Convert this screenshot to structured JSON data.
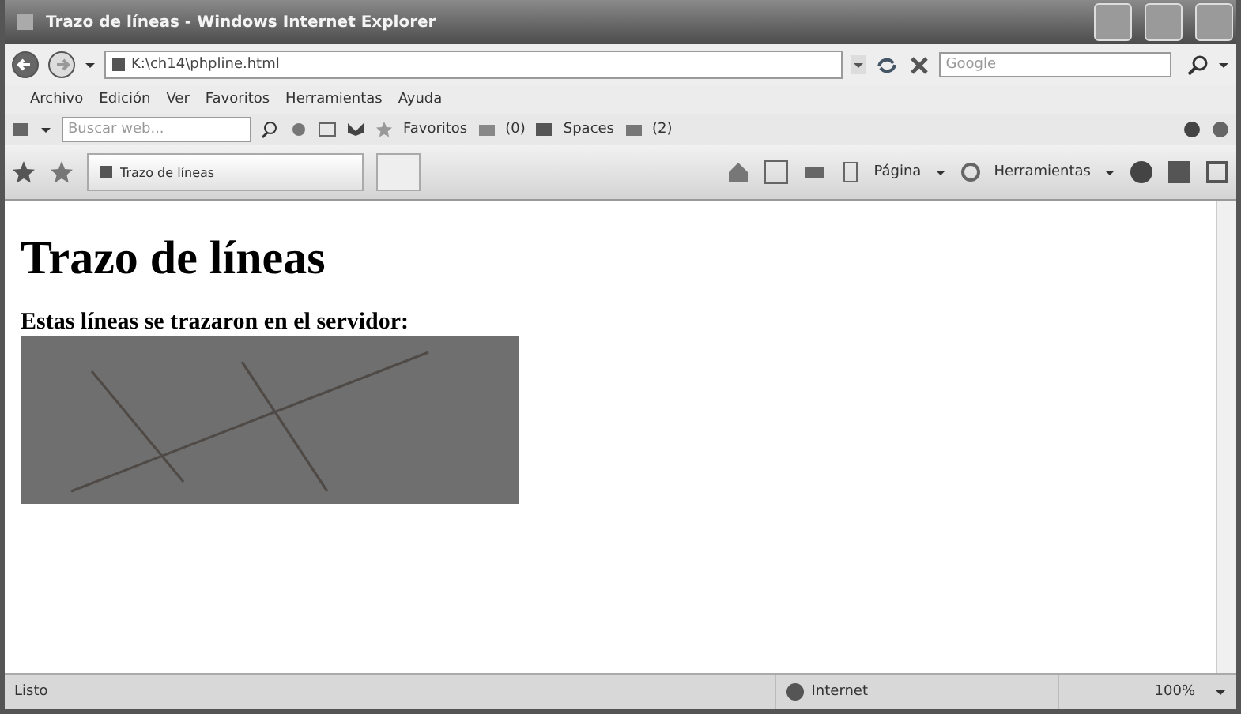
{
  "window": {
    "title": "Trazo de líneas - Windows Internet Explorer"
  },
  "address_bar": {
    "url": "K:\\ch14\\phpline.html",
    "search_placeholder": "Google"
  },
  "menu": [
    "Archivo",
    "Edición",
    "Ver",
    "Favoritos",
    "Herramientas",
    "Ayuda"
  ],
  "links_toolbar": {
    "search_placeholder": "Buscar web...",
    "items": [
      "Favoritos",
      "(0)",
      "Spaces",
      "(2)"
    ]
  },
  "tabs": [
    {
      "label": "Trazo de líneas",
      "selected": true
    }
  ],
  "command_bar": [
    "Página",
    "Herramientas"
  ],
  "page": {
    "heading": "Trazo de líneas",
    "text": "Estas líneas se trazaron en el servidor:"
  },
  "status_bar": {
    "status": "Listo",
    "zone": "Internet",
    "zoom": "100%"
  }
}
